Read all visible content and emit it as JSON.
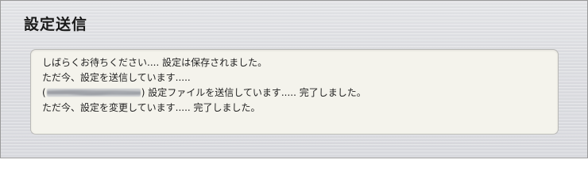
{
  "page": {
    "title": "設定送信"
  },
  "messages": [
    {
      "text": "しばらくお待ちください.... 設定は保存されました。"
    },
    {
      "text": "ただ今、設定を送信しています....."
    },
    {
      "open": "(",
      "close": ")",
      "text": " 設定ファイルを送信しています..... 完了しました。"
    },
    {
      "text": "ただ今、設定を変更しています..... 完了しました。"
    }
  ]
}
